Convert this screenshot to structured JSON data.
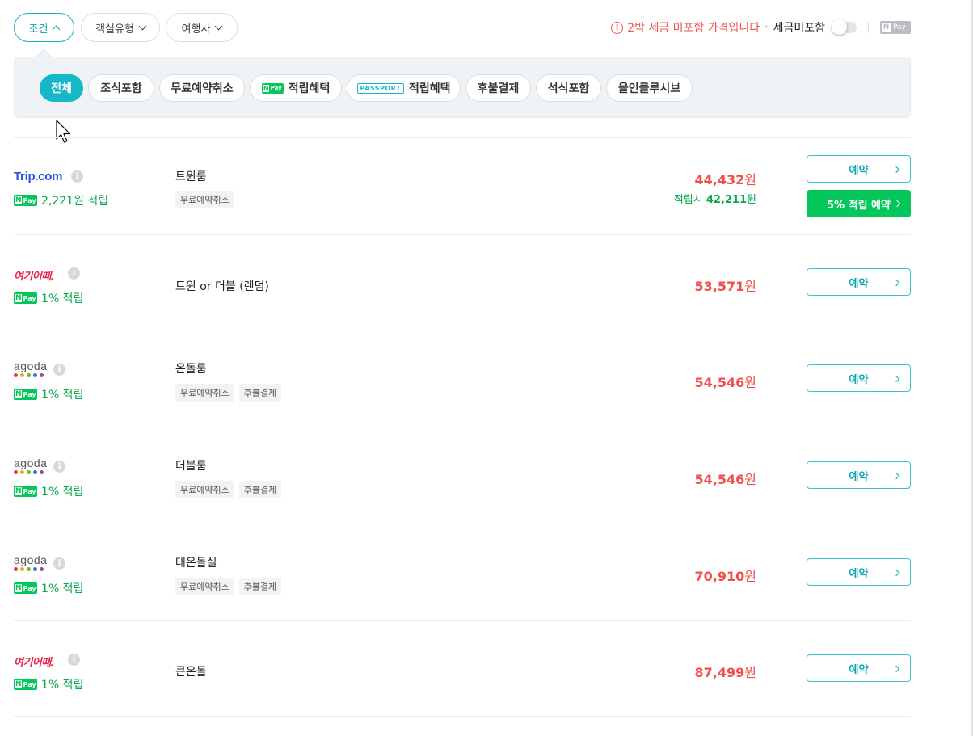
{
  "filters": {
    "condition": "조건",
    "room_type": "객실유형",
    "travel_agency": "여행사"
  },
  "tax_notice": {
    "warning": "2박 세금 미포함 가격입니다",
    "separator": "·",
    "toggle_label": "세금미포함",
    "toggle_on": false,
    "npay_logo": "N Pay"
  },
  "condition_chips": [
    {
      "label": "전체",
      "selected": true
    },
    {
      "label": "조식포함"
    },
    {
      "label": "무료예약취소"
    },
    {
      "label": "적립혜택",
      "badge": "N Pay"
    },
    {
      "label": "적립혜택",
      "badge": "PASSPORT"
    },
    {
      "label": "후불결제"
    },
    {
      "label": "석식포함"
    },
    {
      "label": "올인클루시브"
    }
  ],
  "offers": [
    {
      "provider": "Trip.com",
      "point": "2,221원 적립",
      "room": "트윈룸",
      "tags": [
        "무료예약취소"
      ],
      "price": "44,432",
      "won": "원",
      "accum_prefix": "적립시",
      "accum_price": "42,211",
      "accum_won": "원",
      "reserve": "예약",
      "green_button": "5% 적립 예약"
    },
    {
      "provider": "여기어때.",
      "point": "1% 적립",
      "room": "트윈 or 더블 (랜덤)",
      "tags": [],
      "price": "53,571",
      "won": "원",
      "reserve": "예약"
    },
    {
      "provider": "agoda",
      "point": "1% 적립",
      "room": "온돌룸",
      "tags": [
        "무료예약취소",
        "후불결제"
      ],
      "price": "54,546",
      "won": "원",
      "reserve": "예약"
    },
    {
      "provider": "agoda",
      "point": "1% 적립",
      "room": "더블룸",
      "tags": [
        "무료예약취소",
        "후불결제"
      ],
      "price": "54,546",
      "won": "원",
      "reserve": "예약"
    },
    {
      "provider": "agoda",
      "point": "1% 적립",
      "room": "대온돌실",
      "tags": [
        "무료예약취소",
        "후불결제"
      ],
      "price": "70,910",
      "won": "원",
      "reserve": "예약"
    },
    {
      "provider": "여기어때.",
      "point": "1% 적립",
      "room": "큰온돌",
      "tags": [],
      "price": "87,499",
      "won": "원",
      "reserve": "예약"
    }
  ],
  "icons": {
    "info": "i",
    "warning": "!",
    "npay_n": "N",
    "npay_pay": "Pay"
  },
  "colors": {
    "accent": "#16b8c8",
    "price": "#f0504a",
    "npay_green": "#03c75a",
    "tripcom_blue": "#2a51e0",
    "yeogi_red": "#e8244c",
    "agoda_dots": [
      "#e8412c",
      "#f4a523",
      "#76b82a",
      "#2c7bc9",
      "#a246a8"
    ]
  }
}
